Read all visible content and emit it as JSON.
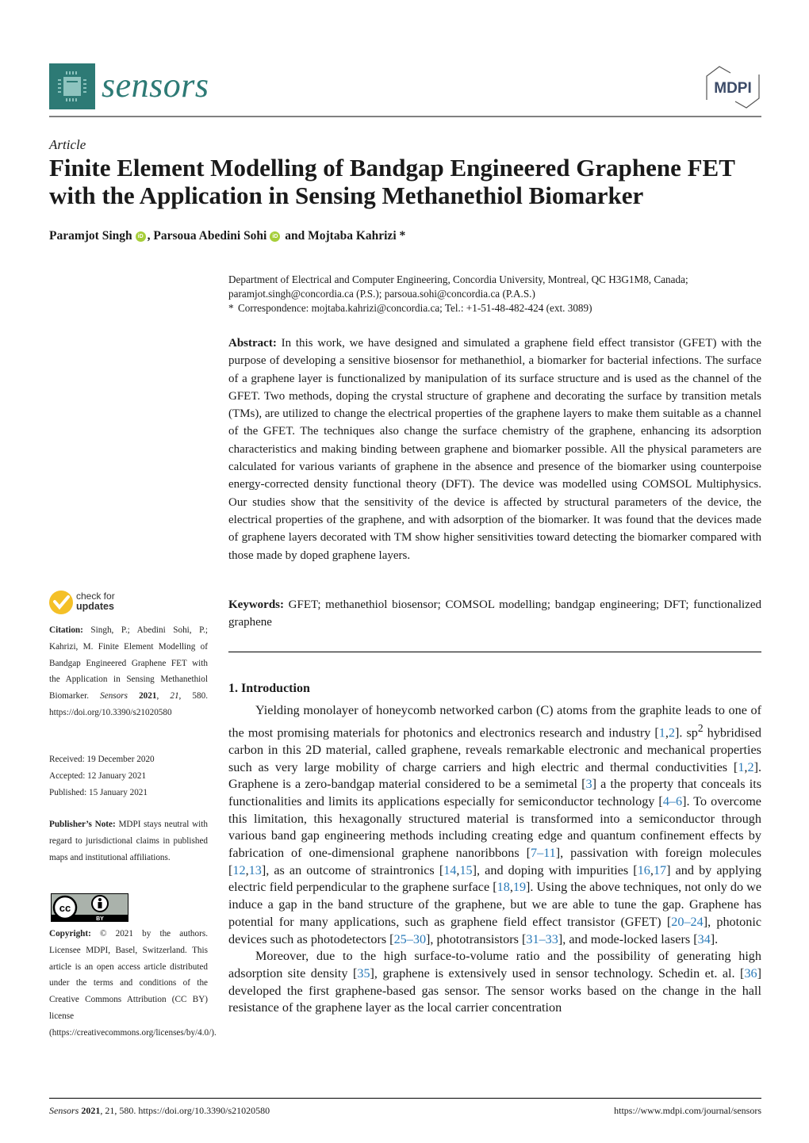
{
  "header": {
    "journal_name": "sensors",
    "publisher_logo_text": "MDPI",
    "brand_color": "#2d7a75"
  },
  "article": {
    "type": "Article",
    "title": "Finite Element Modelling of Bandgap Engineered Graphene FET with the Application in Sensing Methanethiol Biomarker",
    "authors": [
      {
        "name": "Paramjot Singh",
        "orcid": true,
        "separator": ", "
      },
      {
        "name": "Parsoua Abedini Sohi",
        "orcid": true,
        "separator": " and "
      },
      {
        "name": "Mojtaba Kahrizi *",
        "orcid": false,
        "separator": ""
      }
    ],
    "orcid_label": "iD",
    "affiliation": {
      "line1": "Department of Electrical and Computer Engineering, Concordia University, Montreal, QC H3G1M8, Canada;",
      "line2": "paramjot.singh@concordia.ca (P.S.); parsoua.sohi@concordia.ca (P.A.S.)",
      "corr_marker": "*",
      "correspondence": "Correspondence: mojtaba.kahrizi@concordia.ca; Tel.: +1-51-48-482-424 (ext. 3089)"
    },
    "abstract": {
      "label": "Abstract:",
      "text": " In this work, we have designed and simulated a graphene field effect transistor (GFET) with the purpose of developing a sensitive biosensor for methanethiol, a biomarker for bacterial infections. The surface of a graphene layer is functionalized by manipulation of its surface structure and is used as the channel of the GFET. Two methods, doping the crystal structure of graphene and decorating the surface by transition metals (TMs), are utilized to change the electrical properties of the graphene layers to make them suitable as a channel of the GFET. The techniques also change the surface chemistry of the graphene, enhancing its adsorption characteristics and making binding between graphene and biomarker possible. All the physical parameters are calculated for various variants of graphene in the absence and presence of the biomarker using counterpoise energy-corrected density functional theory (DFT). The device was modelled using COMSOL Multiphysics. Our studies show that the sensitivity of the device is affected by structural parameters of the device, the electrical properties of the graphene, and with adsorption of the biomarker. It was found that the devices made of graphene layers decorated with TM show higher sensitivities toward detecting the biomarker compared with those made by doped graphene layers."
    },
    "keywords": {
      "label": "Keywords:",
      "text": " GFET; methanethiol biosensor; COMSOL modelling; bandgap engineering; DFT; functionalized graphene"
    },
    "introduction": {
      "heading": "1. Introduction",
      "p1": [
        {
          "t": "Yielding monolayer of honeycomb networked carbon (C) atoms from the graphite leads to one of the most promising materials for photonics and electronics research and industry ["
        },
        {
          "r": "1"
        },
        {
          "t": ","
        },
        {
          "r": "2"
        },
        {
          "t": "]. sp"
        },
        {
          "sup": "2"
        },
        {
          "t": " hybridised carbon in this 2D material, called graphene, reveals remarkable electronic and mechanical properties such as very large mobility of charge carriers and high electric and thermal conductivities ["
        },
        {
          "r": "1"
        },
        {
          "t": ","
        },
        {
          "r": "2"
        },
        {
          "t": "]. Graphene is a zero-bandgap material considered to be a semimetal ["
        },
        {
          "r": "3"
        },
        {
          "t": "] a the property that conceals its functionalities and limits its applications especially for semiconductor technology ["
        },
        {
          "r": "4–6"
        },
        {
          "t": "]. To overcome this limitation, this hexagonally structured material is transformed into a semiconductor through various band gap engineering methods including creating edge and quantum confinement effects by fabrication of one-dimensional graphene nanoribbons ["
        },
        {
          "r": "7–11"
        },
        {
          "t": "], passivation with foreign molecules ["
        },
        {
          "r": "12"
        },
        {
          "t": ","
        },
        {
          "r": "13"
        },
        {
          "t": "], as an outcome of straintronics ["
        },
        {
          "r": "14"
        },
        {
          "t": ","
        },
        {
          "r": "15"
        },
        {
          "t": "], and doping with impurities ["
        },
        {
          "r": "16"
        },
        {
          "t": ","
        },
        {
          "r": "17"
        },
        {
          "t": "] and by applying electric field perpendicular to the graphene surface ["
        },
        {
          "r": "18"
        },
        {
          "t": ","
        },
        {
          "r": "19"
        },
        {
          "t": "]. Using the above techniques, not only do we induce a gap in the band structure of the graphene, but we are able to tune the gap. Graphene has potential for many applications, such as graphene field effect transistor (GFET) ["
        },
        {
          "r": "20–24"
        },
        {
          "t": "], photonic devices such as photodetectors ["
        },
        {
          "r": "25–30"
        },
        {
          "t": "], phototransistors ["
        },
        {
          "r": "31–33"
        },
        {
          "t": "], and mode-locked lasers ["
        },
        {
          "r": "34"
        },
        {
          "t": "]."
        }
      ],
      "p2": [
        {
          "t": "Moreover, due to the high surface-to-volume ratio and the possibility of generating high adsorption site density ["
        },
        {
          "r": "35"
        },
        {
          "t": "], graphene is extensively used in sensor technology. Schedin et. al. ["
        },
        {
          "r": "36"
        },
        {
          "t": "] developed the first graphene-based gas sensor. The sensor works based on the change in the hall resistance of the graphene layer as the local carrier concentration"
        }
      ],
      "ref_color": "#2a7ab8"
    }
  },
  "sidebar": {
    "check_updates": {
      "line1": "check for",
      "line2": "updates",
      "badge_color": "#f4c027"
    },
    "citation": {
      "label": "Citation:",
      "text_pre": "  Singh, P.; Abedini Sohi, P.; Kahrizi, M. Finite Element Modelling of Bandgap Engineered Graphene FET with the Application in Sensing Methanethiol Biomarker. ",
      "journal": "Sensors",
      "year": "2021",
      "volume": "21",
      "text_post": ", 580. https://doi.org/10.3390/s21020580"
    },
    "dates": {
      "received": "Received: 19 December 2020",
      "accepted": "Accepted: 12 January 2021",
      "published": "Published: 15 January 2021"
    },
    "publisher_note": {
      "label": "Publisher’s Note:",
      "text": "  MDPI stays neutral with regard to jurisdictional claims in published maps and institutional affiliations."
    },
    "cc_badge": {
      "cc": "cc",
      "by": "BY"
    },
    "copyright": {
      "label": "Copyright:",
      "text": " © 2021 by the authors. Licensee MDPI, Basel, Switzerland. This article is an open access article distributed under the terms and conditions of the Creative Commons Attribution (CC BY) license (https://creativecommons.org/licenses/by/4.0/)."
    }
  },
  "footer": {
    "journal": "Sensors",
    "year": "2021",
    "rest": ", 21, 580. https://doi.org/10.3390/s21020580",
    "url": "https://www.mdpi.com/journal/sensors"
  }
}
